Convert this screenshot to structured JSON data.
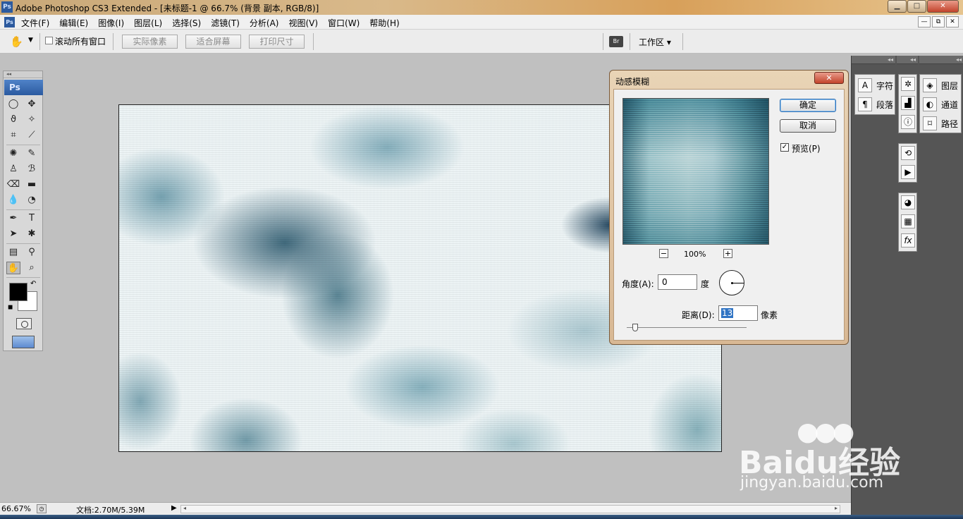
{
  "window": {
    "app_icon": "Ps",
    "title": "Adobe Photoshop CS3 Extended - [未标题-1 @ 66.7% (背景 副本, RGB/8)]",
    "controls": {
      "minimize": "▁",
      "maximize": "□",
      "close": "✕"
    }
  },
  "menubar": {
    "ps_icon": "Ps",
    "items": [
      "文件(F)",
      "编辑(E)",
      "图像(I)",
      "图层(L)",
      "选择(S)",
      "滤镜(T)",
      "分析(A)",
      "视图(V)",
      "窗口(W)",
      "帮助(H)"
    ],
    "doc_controls": [
      "—",
      "⧉",
      "✕"
    ]
  },
  "options_bar": {
    "tool_icon": "hand-icon",
    "scroll_all_windows_label": "滚动所有窗口",
    "scroll_all_windows_checked": false,
    "actual_pixels_label": "实际像素",
    "fit_screen_label": "适合屏幕",
    "print_size_label": "打印尺寸",
    "workspace_label": "工作区 ▾"
  },
  "toolbox": {
    "logo": "Ps",
    "active_tool": "hand-tool",
    "foreground_color": "#000000",
    "background_color": "#ffffff"
  },
  "dialog": {
    "title": "动感模糊",
    "ok_label": "确定",
    "cancel_label": "取消",
    "preview_label": "预览(P)",
    "preview_checked": true,
    "zoom_level": "100%",
    "angle_label": "角度(A):",
    "angle_value": "0",
    "angle_unit": "度",
    "distance_label": "距离(D):",
    "distance_value": "13",
    "distance_unit": "像素"
  },
  "panels": {
    "group1": [
      {
        "icon": "A",
        "label": "字符"
      },
      {
        "icon": "¶",
        "label": "段落"
      }
    ],
    "group2_icons": [
      "navigator-icon",
      "histogram-icon",
      "info-icon"
    ],
    "group3": [
      {
        "icon": "◈",
        "label": "图层"
      },
      {
        "icon": "◐",
        "label": "通道"
      },
      {
        "icon": "⌑",
        "label": "路径"
      }
    ],
    "group4_icons": [
      "history-icon",
      "actions-icon"
    ],
    "group5_icons": [
      "color-icon",
      "swatches-icon",
      "styles-icon"
    ]
  },
  "statusbar": {
    "zoom": "66.67%",
    "doc_size": "文档:2.70M/5.39M"
  },
  "watermark": {
    "logo": "Baidu经验",
    "url": "jingyan.baidu.com"
  },
  "colors": {
    "title_bar": "#d9b98a",
    "canvas_teal": "#2e6b80",
    "dock_bg": "#555555"
  }
}
